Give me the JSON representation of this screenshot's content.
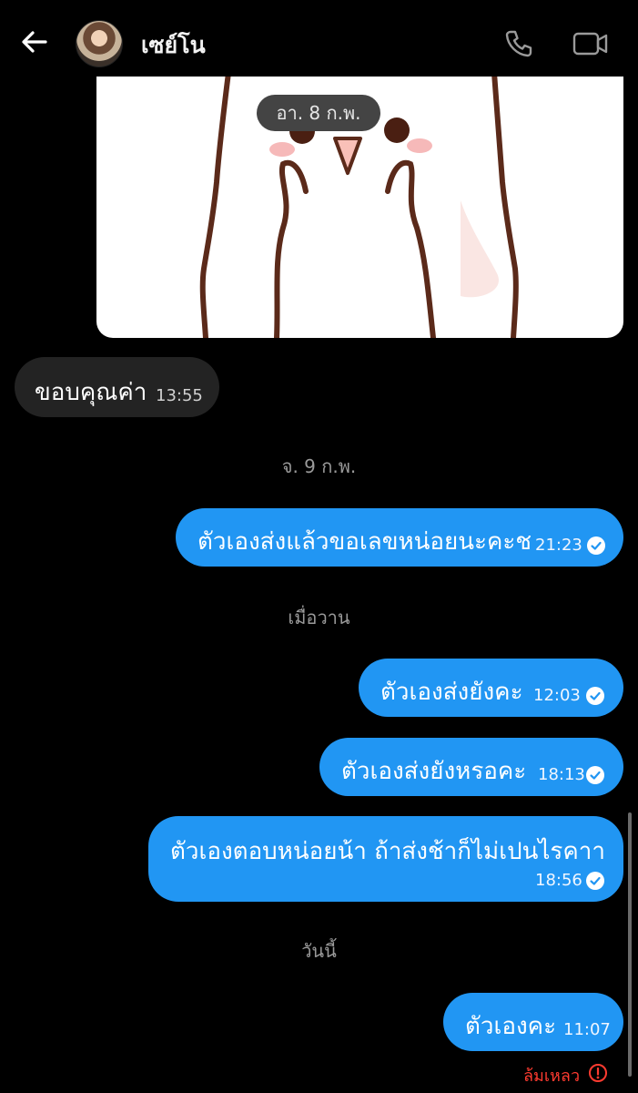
{
  "header": {
    "contact_name": "เซย์โน",
    "icons": {
      "back": "back-arrow-icon",
      "call": "phone-icon",
      "video": "video-camera-icon"
    }
  },
  "date_chip": "อา. 8 ก.พ.",
  "messages": [
    {
      "direction": "incoming",
      "text": "ขอบคุณค่า",
      "time": "13:55"
    },
    {
      "direction": "outgoing",
      "text": "ตัวเองส่งแล้วขอเลขหน่อยนะคะช",
      "time": "21:23",
      "status": "sent"
    },
    {
      "direction": "outgoing",
      "text": "ตัวเองส่งยังคะ",
      "time": "12:03",
      "status": "sent"
    },
    {
      "direction": "outgoing",
      "text": "ตัวเองส่งยังหรอคะ",
      "time": "18:13",
      "status": "sent"
    },
    {
      "direction": "outgoing",
      "text": "ตัวเองตอบหน่อยน้า ถ้าส่งช้าก็ไม่เปนไรคาา",
      "time": "18:56",
      "status": "sent"
    },
    {
      "direction": "outgoing",
      "text": "ตัวเองคะ",
      "time": "11:07",
      "status": "sent"
    }
  ],
  "day_separators": [
    "จ. 9 ก.พ.",
    "เมื่อวาน",
    "วันนี้"
  ],
  "failed_label": "ล้มเหลว",
  "colors": {
    "outgoing_bubble": "#2196f3",
    "incoming_bubble": "#232323",
    "error": "#ff3b30",
    "background": "#000000"
  }
}
